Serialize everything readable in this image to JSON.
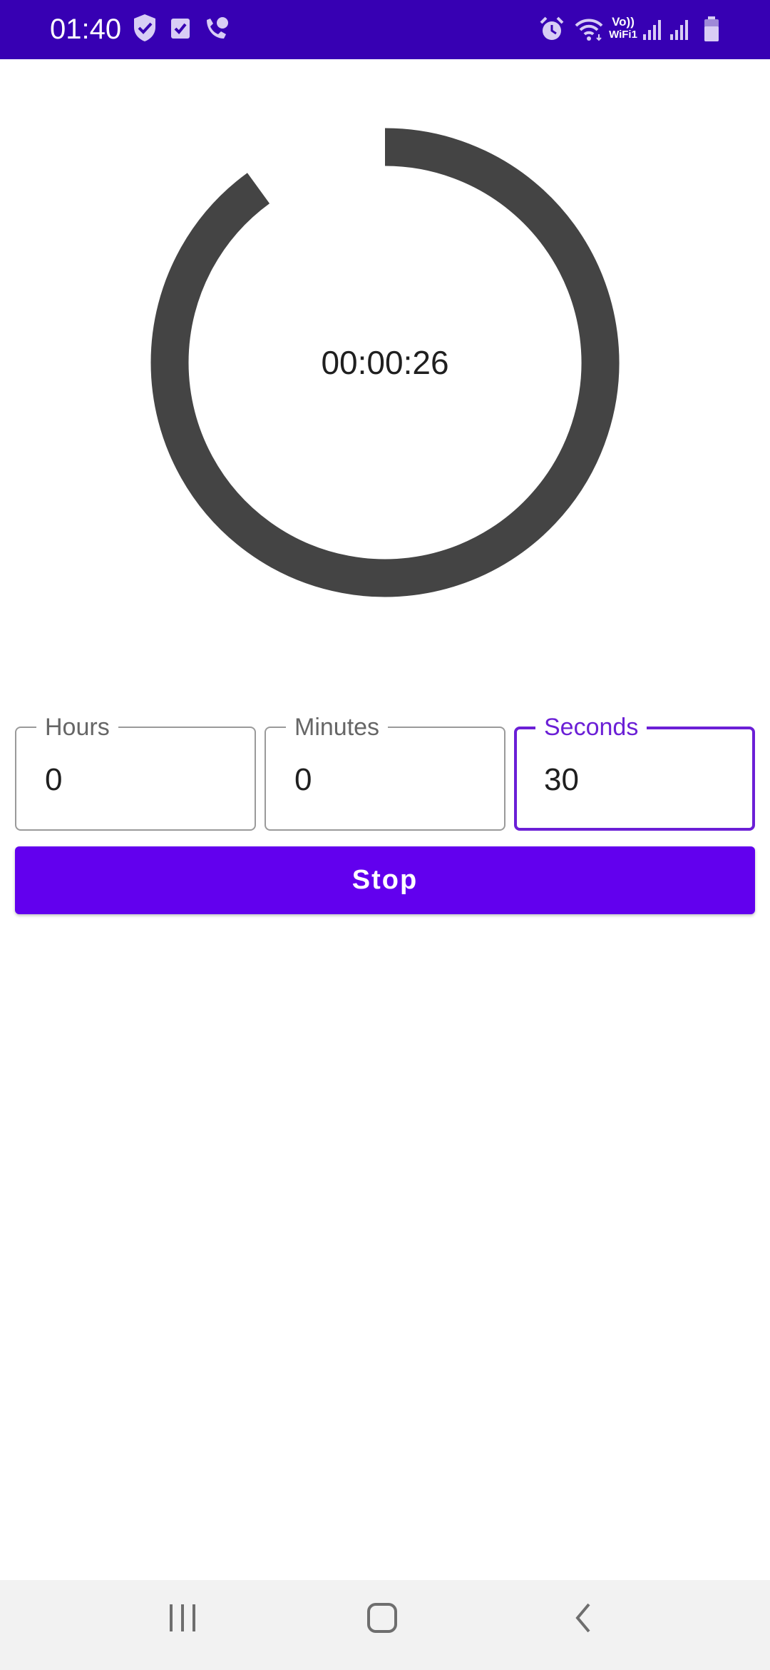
{
  "status_bar": {
    "time": "01:40",
    "left_icons": [
      "shield-check-icon",
      "checkbox-icon",
      "wifi-call-icon"
    ],
    "right_icons": [
      "alarm-icon",
      "wifi-icon",
      "vowifi-indicator",
      "signal-1-icon",
      "signal-2-icon",
      "battery-icon"
    ],
    "vowifi_line1": "Vo))",
    "vowifi_line2": "WiFi1",
    "background_color": "#3700b3"
  },
  "timer": {
    "display": "00:00:26",
    "progress_fraction": 0.9,
    "ring_color": "#444444"
  },
  "fields": {
    "hours": {
      "label": "Hours",
      "value": "0"
    },
    "minutes": {
      "label": "Minutes",
      "value": "0"
    },
    "seconds": {
      "label": "Seconds",
      "value": "30",
      "focused": true
    }
  },
  "stop_button": {
    "label": "Stop",
    "color": "#6200ee"
  },
  "nav_bar": {
    "buttons": [
      "recent-apps-icon",
      "home-icon",
      "back-icon"
    ]
  },
  "colors": {
    "accent": "#6200ee",
    "focus": "#6b1fd6"
  }
}
